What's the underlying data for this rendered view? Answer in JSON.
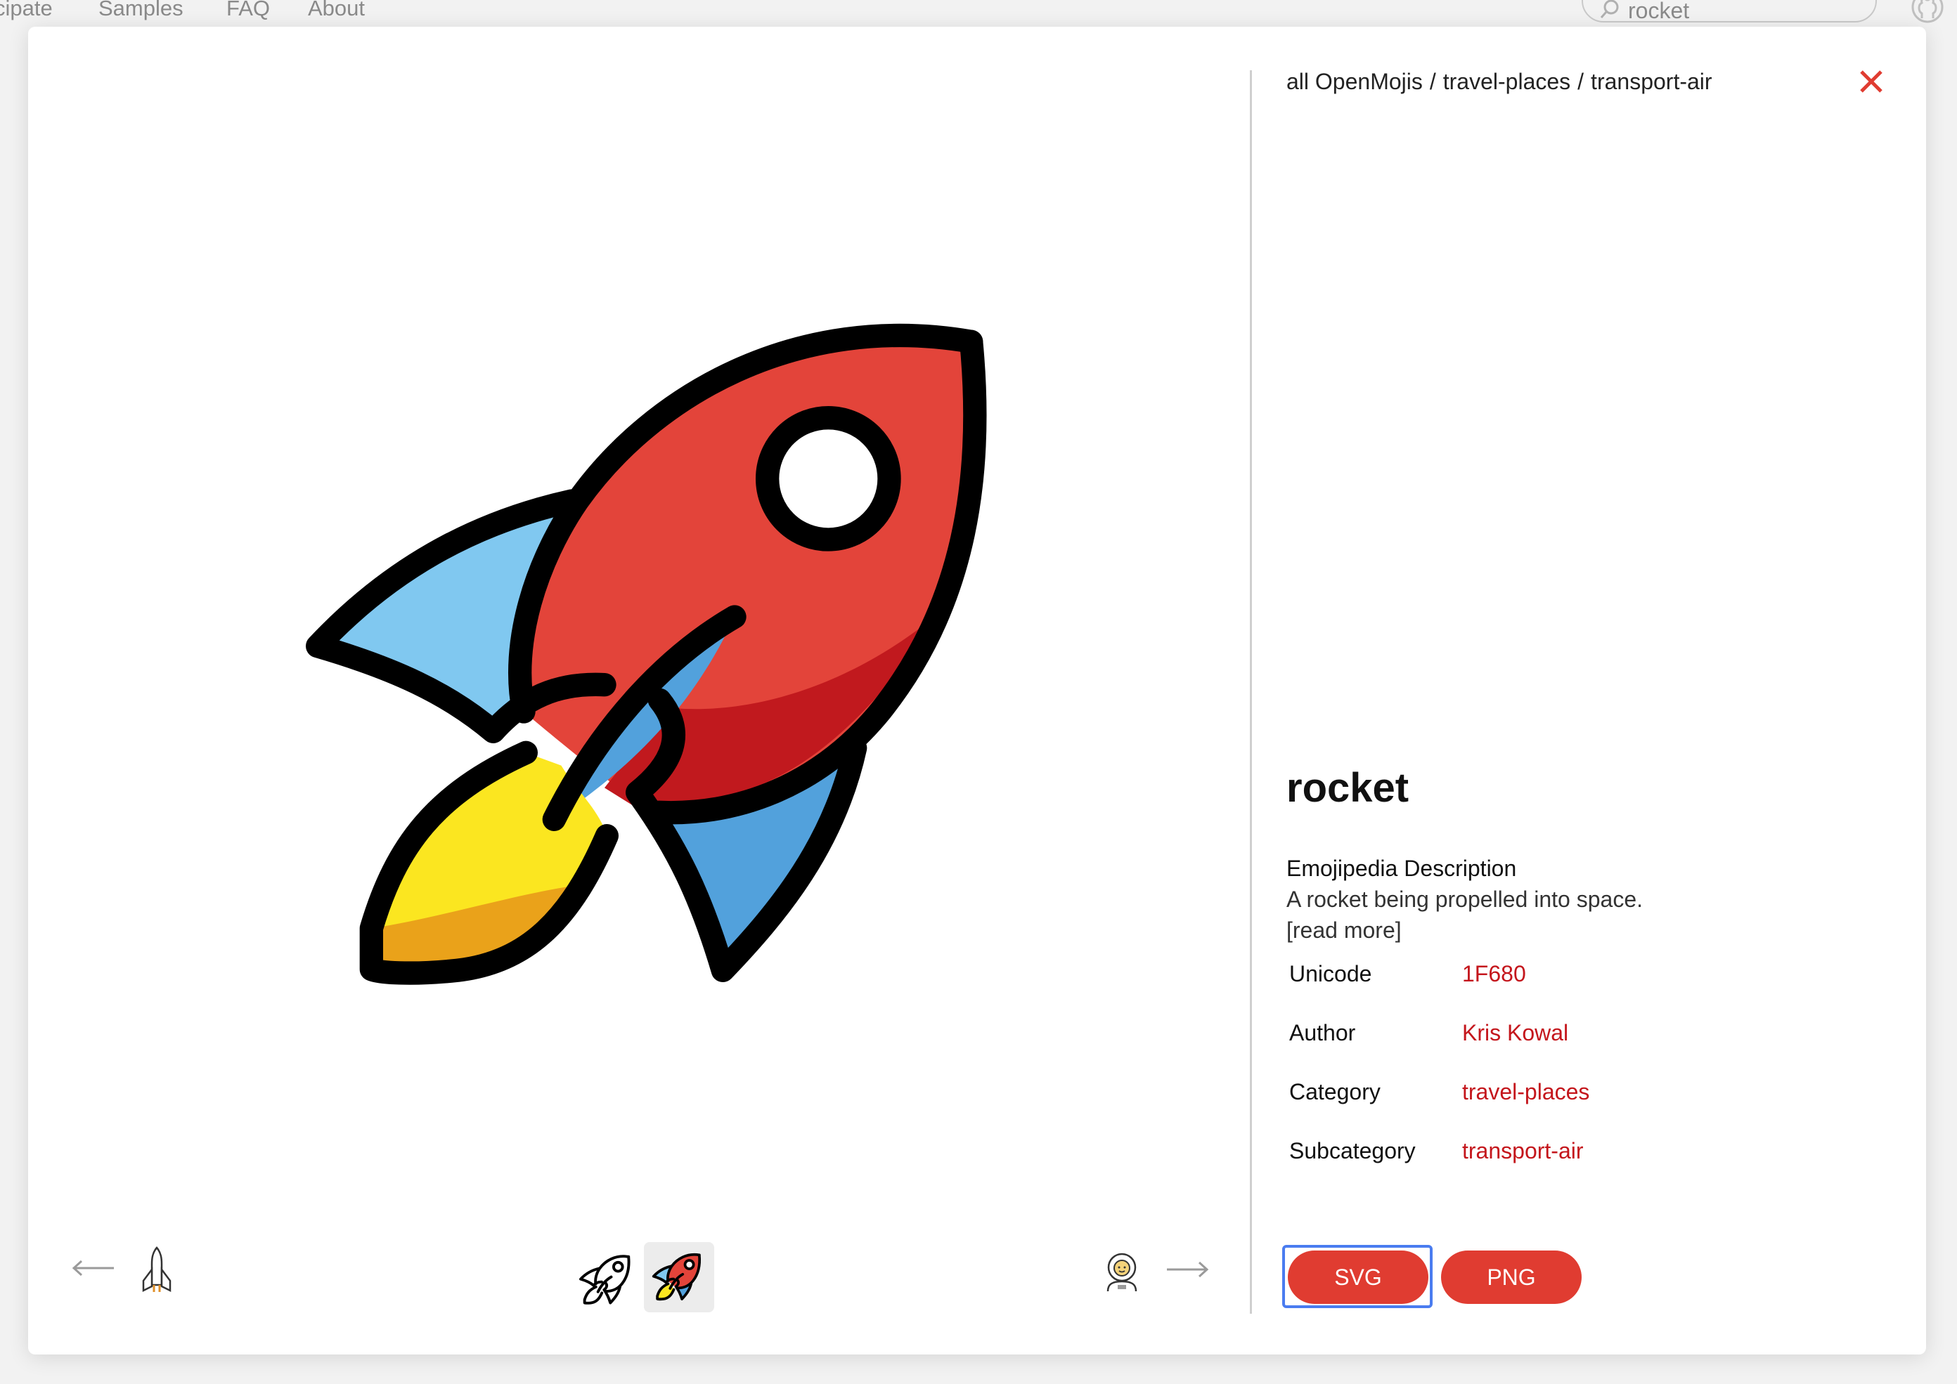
{
  "site_nav": {
    "items": [
      "cipate",
      "Samples",
      "FAQ",
      "About"
    ],
    "search_value": "rocket"
  },
  "modal": {
    "breadcrumb": [
      "all OpenMojis",
      "travel-places",
      "transport-air"
    ],
    "breadcrumb_sep": "/",
    "title": "rocket",
    "description_heading": "Emojipedia Description",
    "description_text": "A rocket being propelled into space.",
    "read_more": "[read more]",
    "meta": [
      {
        "label": "Unicode",
        "value": "1F680"
      },
      {
        "label": "Author",
        "value": "Kris Kowal"
      },
      {
        "label": "Category",
        "value": "travel-places"
      },
      {
        "label": "Subcategory",
        "value": "transport-air"
      }
    ],
    "buttons": {
      "svg": "SVG",
      "png": "PNG"
    },
    "icons": {
      "close": "close-icon",
      "prev": "arrow-left-icon",
      "next": "arrow-right-icon",
      "prev_emoji": "space-shuttle-icon",
      "next_emoji": "astronaut-icon",
      "variant_mono": "rocket-outline-icon",
      "variant_color": "rocket-color-icon"
    },
    "colors": {
      "accent": "#e03c31",
      "link": "#c4161c",
      "focus": "#4a7cf0",
      "rocket_body": "#e3443a",
      "rocket_shadow": "#c1191e",
      "fin_light": "#80c8f0",
      "fin_dark": "#52a1dc",
      "flame": "#fbe620",
      "flame_shadow": "#eaa21a"
    }
  }
}
